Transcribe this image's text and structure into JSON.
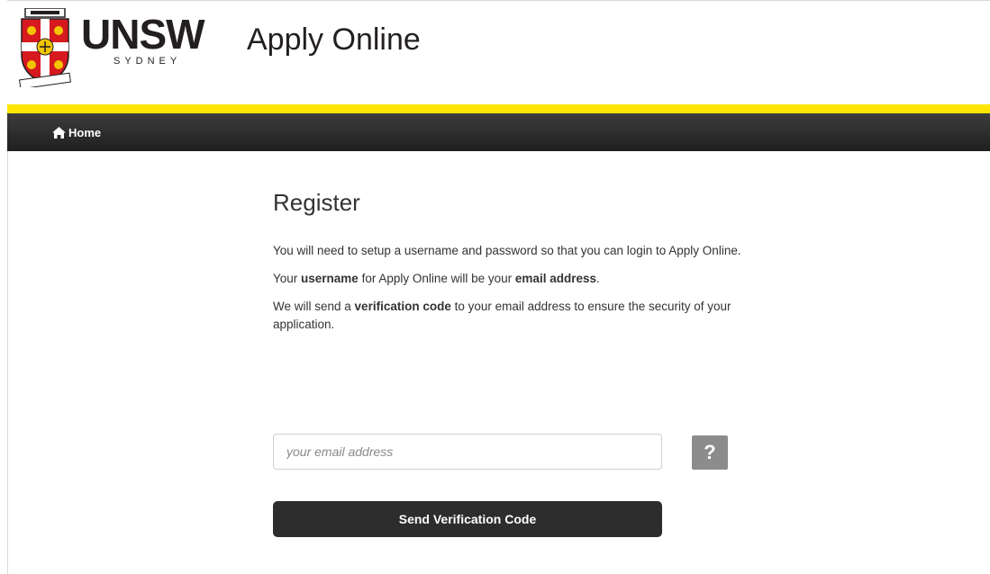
{
  "header": {
    "logo_wordmark": "UNSW",
    "logo_subtext": "SYDNEY",
    "app_title": "Apply Online"
  },
  "nav": {
    "home_label": "Home",
    "home_icon": "home-icon"
  },
  "main": {
    "title": "Register",
    "intro_line": "You will need to setup a username and password so that you can login to Apply Online.",
    "username_pre": "Your ",
    "username_bold": "username",
    "username_mid": " for Apply Online will be your ",
    "username_bold2": "email address",
    "username_post": ".",
    "verify_pre": "We will send a ",
    "verify_bold": "verification code",
    "verify_post": " to your email address to ensure the security of your application."
  },
  "form": {
    "email_placeholder": "your email address",
    "email_value": "",
    "help_label": "?",
    "send_button_label": "Send Verification Code"
  },
  "colors": {
    "accent_yellow": "#ffe600",
    "nav_dark": "#2d2d2d",
    "help_gray": "#8c8c8c"
  }
}
